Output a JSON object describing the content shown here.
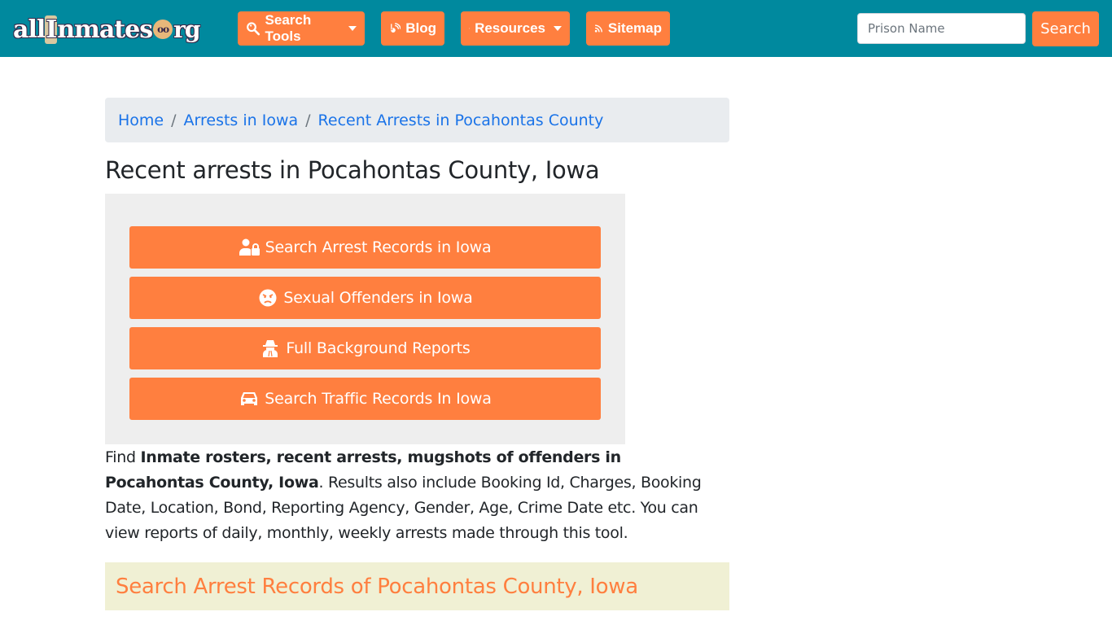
{
  "header": {
    "logo": {
      "part1": "all",
      "part2": "I",
      "part3": "nmates",
      "badge": "oo",
      "part4": "rg",
      "alt": "allinmates.org"
    },
    "nav": [
      {
        "label": "Search Tools",
        "icon": "search-icon",
        "dropdown": true
      },
      {
        "label": "Blog",
        "icon": "blogger-icon",
        "dropdown": false
      },
      {
        "label": "Resources",
        "icon": "leaf-icon",
        "dropdown": true
      },
      {
        "label": "Sitemap",
        "icon": "rss-icon",
        "dropdown": false
      }
    ],
    "search": {
      "placeholder": "Prison Name",
      "value": "",
      "button_label": "Search"
    }
  },
  "breadcrumb": [
    {
      "label": "Home"
    },
    {
      "label": "Arrests in Iowa"
    },
    {
      "label": "Recent Arrests in Pocahontas County"
    }
  ],
  "main": {
    "title": "Recent arrests in Pocahontas County, Iowa",
    "cta_buttons": [
      {
        "label": "Search Arrest Records in Iowa",
        "icon": "user-lock-icon"
      },
      {
        "label": "Sexual Offenders in Iowa",
        "icon": "angry-face-icon"
      },
      {
        "label": "Full Background Reports",
        "icon": "user-secret-icon"
      },
      {
        "label": "Search Traffic Records In Iowa",
        "icon": "car-icon"
      }
    ],
    "intro": {
      "lead": "Find ",
      "bold": "Inmate rosters, recent arrests, mugshots of offenders in Pocahontas County, Iowa",
      "rest": ". Results also include Booking Id, Charges, Booking Date, Location, Bond, Reporting Agency, Gender, Age, Crime Date etc. You can view reports of daily, monthly, weekly arrests made through this tool."
    },
    "section_heading": "Search Arrest Records of Pocahontas County, Iowa"
  },
  "colors": {
    "navbar": "#00899e",
    "accent": "#ff7f3f",
    "link": "#1a73e8",
    "breadcrumb_bg": "#e9ecef",
    "cta_box_bg": "#eeeeee",
    "section_bg": "#f0f0d4"
  }
}
